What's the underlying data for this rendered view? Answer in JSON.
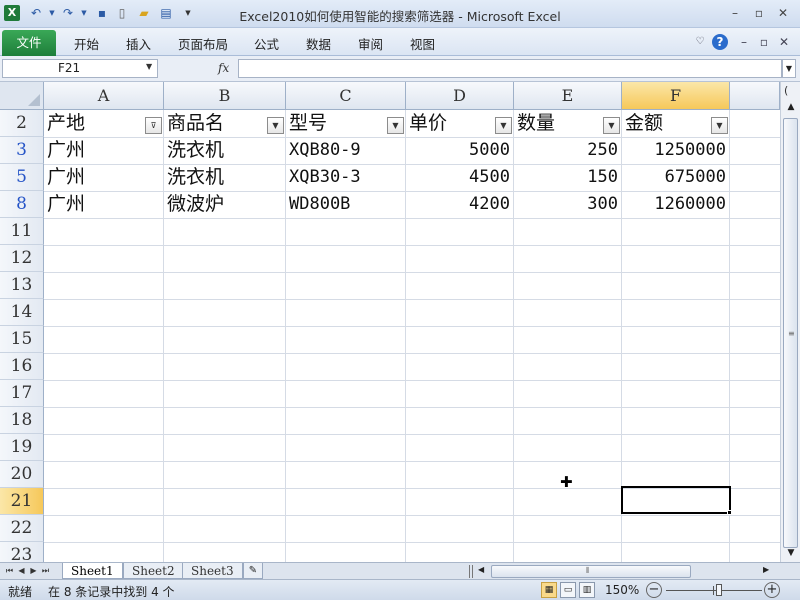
{
  "title_bar": {
    "title": "Excel2010如何使用智能的搜索筛选器 - Microsoft Excel"
  },
  "ribbon": {
    "file_label": "文件",
    "tabs": [
      "开始",
      "插入",
      "页面布局",
      "公式",
      "数据",
      "审阅",
      "视图"
    ]
  },
  "formula_bar": {
    "name_box": "F21",
    "fx_label": "fx",
    "formula": ""
  },
  "columns": [
    "A",
    "B",
    "C",
    "D",
    "E",
    "F"
  ],
  "selected_column": "F",
  "row_headers": [
    "2",
    "3",
    "5",
    "8",
    "11",
    "12",
    "13",
    "14",
    "15",
    "16",
    "17",
    "18",
    "19",
    "20",
    "21",
    "22",
    "23"
  ],
  "filtered_rows": [
    "3",
    "5",
    "8"
  ],
  "selected_row": "21",
  "table": {
    "headers": [
      "产地",
      "商品名",
      "型号",
      "单价",
      "数量",
      "金额"
    ],
    "active_filter_column": "产地",
    "rows": [
      [
        "广州",
        "洗衣机",
        "XQB80-9",
        "5000",
        "250",
        "1250000"
      ],
      [
        "广州",
        "洗衣机",
        "XQB30-3",
        "4500",
        "150",
        "675000"
      ],
      [
        "广州",
        "微波炉",
        "WD800B",
        "4200",
        "300",
        "1260000"
      ]
    ]
  },
  "active_cell": "F21",
  "sheets": [
    "Sheet1",
    "Sheet2",
    "Sheet3"
  ],
  "active_sheet": "Sheet1",
  "status_bar": {
    "ready": "就绪",
    "filter_message": "在 8 条记录中找到 4 个",
    "zoom": "150%",
    "zoom_out": "−",
    "zoom_in": "+"
  },
  "icons": {
    "app": "excel-icon",
    "undo": "undo-icon",
    "redo": "redo-icon",
    "save": "save-icon",
    "new": "new-document-icon",
    "open": "open-folder-icon",
    "print": "print-preview-icon",
    "customize": "customize-qat-icon"
  },
  "colors": {
    "file_tab": "#1e7e3a",
    "selection_header": "#f6c85a",
    "filtered_row_number": "#2554c7"
  }
}
